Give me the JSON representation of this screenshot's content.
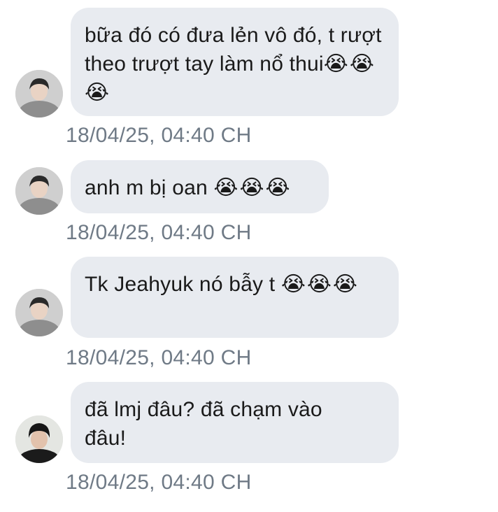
{
  "messages": [
    {
      "text": "bữa đó có đưa lẻn vô đó, t rượt theo trượt tay làm nổ thui",
      "emoji": "😭😭😭",
      "time": "18/04/25, 04:40 CH",
      "avatar": "avatar-user-a"
    },
    {
      "text": "anh m bị oan ",
      "emoji": "😭😭😭",
      "time": "18/04/25, 04:40 CH",
      "avatar": "avatar-user-a"
    },
    {
      "text": "Tk Jeahyuk nó bẫy t ",
      "emoji": "😭😭😭",
      "time": "18/04/25, 04:40 CH",
      "avatar": "avatar-user-a"
    },
    {
      "text": "đã lmj đâu? đã chạm vào đâu!",
      "emoji": "",
      "time": "18/04/25, 04:40 CH",
      "avatar": "avatar-user-b"
    }
  ],
  "colors": {
    "bubble": "#e8ebf0",
    "timestamp": "#6f7a86",
    "text": "#1a1a1a"
  }
}
